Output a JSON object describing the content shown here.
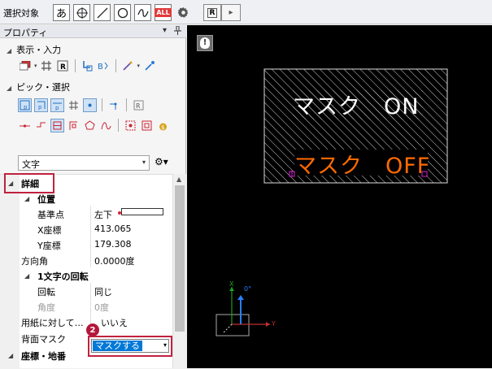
{
  "toolbar": {
    "label": "選択対象",
    "buttons": [
      {
        "name": "hiragana-a-button",
        "glyph": "あ"
      },
      {
        "name": "crosshair-button",
        "icon": "crosshair-icon"
      },
      {
        "name": "line-button",
        "icon": "line-icon"
      },
      {
        "name": "circle-button",
        "icon": "circle-icon"
      },
      {
        "name": "curve-button",
        "icon": "curve-icon"
      },
      {
        "name": "all-button",
        "glyph": "ALL"
      },
      {
        "name": "settings-button",
        "icon": "gear-icon"
      }
    ],
    "r_button": "R",
    "r_arrow": "▸"
  },
  "panel": {
    "title": "プロパティ",
    "pin": "▾",
    "close": "ᛘ",
    "sections": {
      "display_input": "表示・入力",
      "pick_select": "ピック・選択"
    },
    "object_combo": {
      "value": "文字",
      "arrow": "▾"
    },
    "combo_gear_arrow": "⚙▾"
  },
  "properties": {
    "detail_header": "詳細",
    "position_header": "位置",
    "rows": [
      {
        "key": "基準点",
        "value": "左下"
      },
      {
        "key": "X座標",
        "value": "413.065"
      },
      {
        "key": "Y座標",
        "value": "179.308"
      },
      {
        "key": "方向角",
        "value": "0.0000度"
      }
    ],
    "char_rotation_header": "1文字の回転",
    "rotation_rows": [
      {
        "key": "回転",
        "value": "同じ"
      },
      {
        "key": "角度",
        "value": "0度"
      }
    ],
    "paper_row": {
      "key": "用紙に対して…",
      "value": "いいえ"
    },
    "mask_row": {
      "key": "背面マスク",
      "value": "マスクする",
      "arrow": "▾"
    },
    "coord_header": "座標・地番",
    "step_badge": "2"
  },
  "canvas": {
    "button_glyph": "!",
    "text_on": "マスク　ON",
    "text_off": "マスク　OFF",
    "axis_x": "X",
    "axis_y": "Y",
    "origin_label": "0°",
    "colors": {
      "background": "#000000",
      "text_on": "#ffffff",
      "text_off": "#ff6a00",
      "handle": "#d020d0",
      "axis_x": "#c03030",
      "axis_y": "#20a020",
      "axis_z": "#2a7fff"
    }
  },
  "colors": {
    "highlight_box": "#c0223f",
    "selection": "#0078d7"
  }
}
